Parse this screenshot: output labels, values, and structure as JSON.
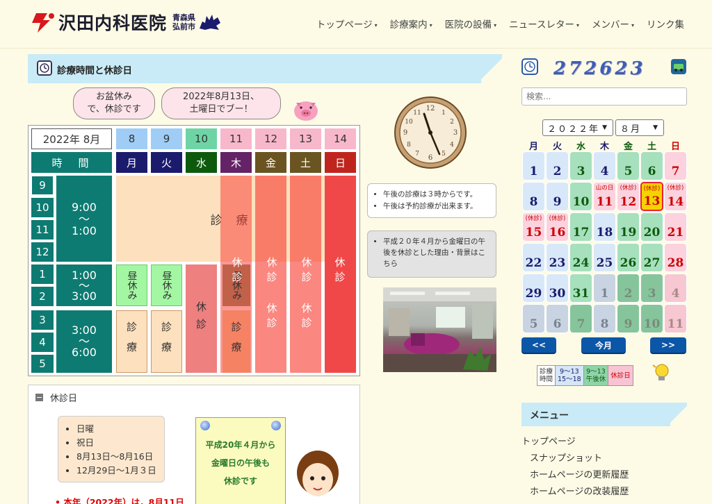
{
  "header": {
    "logo_text": "沢田内科医院",
    "logo_sub_1": "青森県",
    "logo_sub_2": "弘前市",
    "nav": [
      {
        "label": "トップページ",
        "caret": true
      },
      {
        "label": "診療案内",
        "caret": true
      },
      {
        "label": "医院の設備",
        "caret": true
      },
      {
        "label": "ニュースレター",
        "caret": true
      },
      {
        "label": "メンバー",
        "caret": true
      },
      {
        "label": "リンク集",
        "caret": false
      }
    ],
    "caret_glyph": "▾"
  },
  "section": {
    "title": "診療時間と休診日"
  },
  "bubbles": {
    "left_1": "お盆休み",
    "left_2": "で、休診です",
    "right_1": "2022年8月13日、",
    "right_2": "土曜日でブー！"
  },
  "schedule": {
    "month_label": "2022年 8月",
    "time_header": "時　間",
    "dates": [
      "8",
      "9",
      "10",
      "11",
      "12",
      "13",
      "14"
    ],
    "weekdays": [
      "月",
      "火",
      "水",
      "木",
      "金",
      "土",
      "日"
    ],
    "hours": [
      "9",
      "10",
      "11",
      "12",
      "1",
      "2",
      "3",
      "4",
      "5"
    ],
    "slot_am_1": "9:00",
    "slot_am_2": "～",
    "slot_am_3": "1:00",
    "slot_mid_1": "1:00",
    "slot_mid_2": "～",
    "slot_mid_3": "3:00",
    "slot_pm_1": "3:00",
    "slot_pm_2": "～",
    "slot_pm_3": "6:00",
    "am_label_1": "診",
    "am_label_2": "療",
    "lunch": "昼休み",
    "closed": "休診",
    "clinic": "診療"
  },
  "notes": {
    "note1": [
      "午後の診療は３時からです。",
      "午後は予約診療が出来ます。"
    ],
    "note2": "平成２０年４月から金曜日の午後を休診とした理由・背景はこちら"
  },
  "holidays": {
    "title": "休診日",
    "items": [
      "日曜",
      "祝日",
      "8月13日～8月16日",
      "12月29日～1月３日"
    ],
    "red_line": "本年（2022年）は，8月11日",
    "poster_1": "平成20年４月から",
    "poster_2": "金曜日の午後も",
    "poster_3": "休診です"
  },
  "sidebar": {
    "counter": "272623",
    "search_placeholder": "検索...",
    "year_select": "２０２２年",
    "month_select": "８月",
    "dow": [
      "月",
      "火",
      "水",
      "木",
      "金",
      "土",
      "日"
    ],
    "calendar": [
      {
        "n": "1",
        "t": ""
      },
      {
        "n": "2",
        "t": ""
      },
      {
        "n": "3",
        "t": ""
      },
      {
        "n": "4",
        "t": ""
      },
      {
        "n": "5",
        "t": ""
      },
      {
        "n": "6",
        "t": ""
      },
      {
        "n": "7",
        "t": ""
      },
      {
        "n": "8",
        "t": ""
      },
      {
        "n": "9",
        "t": ""
      },
      {
        "n": "10",
        "t": ""
      },
      {
        "n": "11",
        "t": "山の日"
      },
      {
        "n": "12",
        "t": "(休診)"
      },
      {
        "n": "13",
        "t": "(休診)"
      },
      {
        "n": "14",
        "t": "(休診)"
      },
      {
        "n": "15",
        "t": "(休診)"
      },
      {
        "n": "16",
        "t": "(休診)"
      },
      {
        "n": "17",
        "t": ""
      },
      {
        "n": "18",
        "t": ""
      },
      {
        "n": "19",
        "t": ""
      },
      {
        "n": "20",
        "t": ""
      },
      {
        "n": "21",
        "t": ""
      },
      {
        "n": "22",
        "t": ""
      },
      {
        "n": "23",
        "t": ""
      },
      {
        "n": "24",
        "t": ""
      },
      {
        "n": "25",
        "t": ""
      },
      {
        "n": "26",
        "t": ""
      },
      {
        "n": "27",
        "t": ""
      },
      {
        "n": "28",
        "t": ""
      },
      {
        "n": "29",
        "t": ""
      },
      {
        "n": "30",
        "t": ""
      },
      {
        "n": "31",
        "t": ""
      },
      {
        "n": "1",
        "t": ""
      },
      {
        "n": "2",
        "t": ""
      },
      {
        "n": "3",
        "t": ""
      },
      {
        "n": "4",
        "t": ""
      },
      {
        "n": "5",
        "t": ""
      },
      {
        "n": "6",
        "t": ""
      },
      {
        "n": "7",
        "t": ""
      },
      {
        "n": "8",
        "t": ""
      },
      {
        "n": "9",
        "t": ""
      },
      {
        "n": "10",
        "t": ""
      },
      {
        "n": "11",
        "t": ""
      }
    ],
    "prev": "<<",
    "today": "今月",
    "next": ">>",
    "legend_1a": "診療",
    "legend_1b": "時間",
    "legend_2a": "9～13",
    "legend_2b": "15～18",
    "legend_3a": "9～13",
    "legend_3b": "午後休",
    "legend_4": "休診日",
    "menu_title": "メニュー",
    "menu_items": [
      "トップページ",
      "スナップショット",
      "ホームページの更新履歴",
      "ホームページの改装履歴"
    ]
  },
  "colors": {
    "teal": "#0e7b72",
    "navy": "#1b1b6e",
    "closed_red": "#f04848",
    "clinic_peach": "#fde0bd",
    "lunch_green": "#a3f7a3"
  }
}
